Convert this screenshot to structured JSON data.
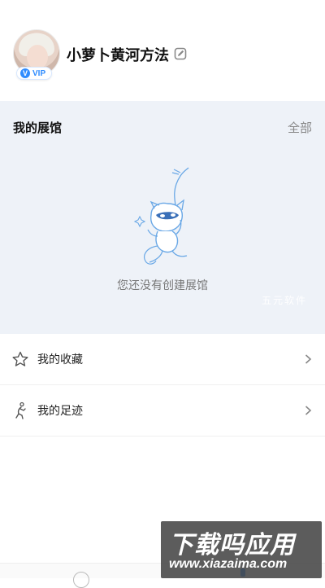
{
  "profile": {
    "username": "小萝卜黄河方法",
    "vip_label": "VIP",
    "vip_mark": "V"
  },
  "gallery": {
    "title": "我的展馆",
    "view_all_label": "全部",
    "empty_text": "您还没有创建展馆",
    "watermark_text": "五元软件"
  },
  "menu": {
    "items": [
      {
        "label": "我的收藏",
        "icon": "star-icon"
      },
      {
        "label": "我的足迹",
        "icon": "footprint-icon"
      }
    ]
  },
  "site_watermark": {
    "title": "下载吗应用",
    "url": "www.xiazaima.com"
  },
  "colors": {
    "accent": "#2f8cff",
    "section_background": "#eef2f8"
  }
}
